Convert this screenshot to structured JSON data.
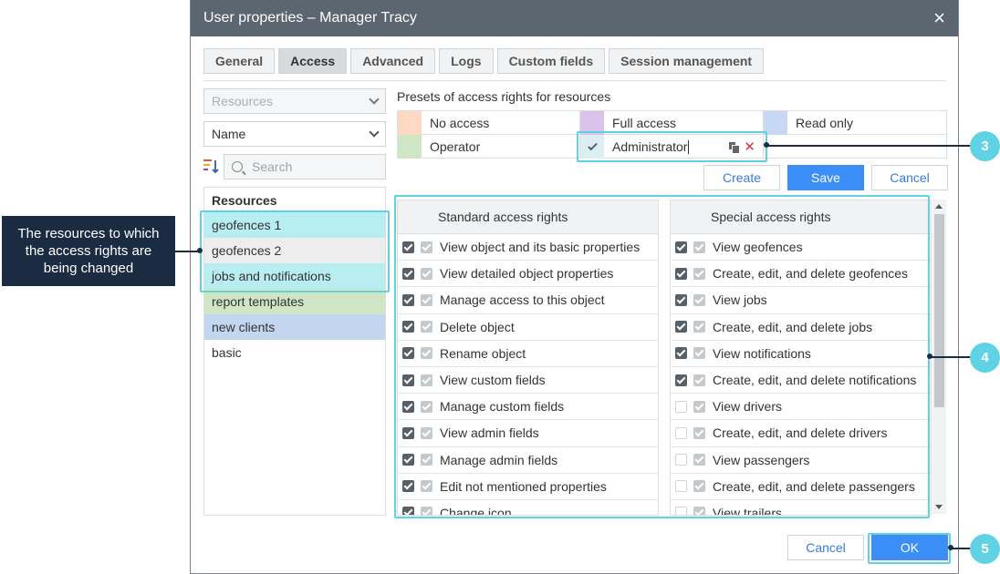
{
  "window": {
    "title": "User properties – Manager Tracy",
    "close": "×"
  },
  "tabs": [
    "General",
    "Access",
    "Advanced",
    "Logs",
    "Custom fields",
    "Session management"
  ],
  "left": {
    "type_select": "Resources",
    "sort_select": "Name",
    "search_placeholder": "Search",
    "list_header": "Resources",
    "items": [
      {
        "label": "geofences 1",
        "color": "#b8eef2"
      },
      {
        "label": "geofences 2",
        "color": "#ededed"
      },
      {
        "label": "jobs and notifications",
        "color": "#b8eef2"
      },
      {
        "label": "report templates",
        "color": "#cfe6c4"
      },
      {
        "label": "new clients",
        "color": "#c3d6f0"
      },
      {
        "label": "basic",
        "color": "#ffffff"
      }
    ]
  },
  "presets": {
    "label": "Presets of access rights for resources",
    "items": [
      {
        "label": "No access",
        "color": "#fdd9c3"
      },
      {
        "label": "Full access",
        "color": "#d9c3ea"
      },
      {
        "label": "Read only",
        "color": "#c6d8f3"
      },
      {
        "label": "Operator",
        "color": "#cfe6c4"
      },
      {
        "label": "Administrator",
        "color": "#ddeef3"
      }
    ],
    "create": "Create",
    "save": "Save",
    "cancel": "Cancel"
  },
  "standard": {
    "header": "Standard access rights",
    "rows": [
      {
        "label": "View object and its basic properties",
        "a": "on"
      },
      {
        "label": "View detailed object properties",
        "a": "on"
      },
      {
        "label": "Manage access to this object",
        "a": "on"
      },
      {
        "label": "Delete object",
        "a": "on"
      },
      {
        "label": "Rename object",
        "a": "on"
      },
      {
        "label": "View custom fields",
        "a": "on"
      },
      {
        "label": "Manage custom fields",
        "a": "on"
      },
      {
        "label": "View admin fields",
        "a": "on"
      },
      {
        "label": "Manage admin fields",
        "a": "on"
      },
      {
        "label": "Edit not mentioned properties",
        "a": "on"
      },
      {
        "label": "Change icon",
        "a": "on"
      }
    ]
  },
  "special": {
    "header": "Special access rights",
    "rows": [
      {
        "label": "View geofences",
        "a": "on"
      },
      {
        "label": "Create, edit, and delete geofences",
        "a": "on"
      },
      {
        "label": "View jobs",
        "a": "on"
      },
      {
        "label": "Create, edit, and delete jobs",
        "a": "on"
      },
      {
        "label": "View notifications",
        "a": "on"
      },
      {
        "label": "Create, edit, and delete notifications",
        "a": "on"
      },
      {
        "label": "View drivers",
        "a": "off"
      },
      {
        "label": "Create, edit, and delete drivers",
        "a": "off"
      },
      {
        "label": "View passengers",
        "a": "off"
      },
      {
        "label": "Create, edit, and delete passengers",
        "a": "off"
      },
      {
        "label": "View trailers",
        "a": "off"
      }
    ]
  },
  "footer": {
    "cancel": "Cancel",
    "ok": "OK"
  },
  "annotations": {
    "note": "The resources to  which the access rights are being changed",
    "c3": "3",
    "c4": "4",
    "c5": "5",
    "highlight_color": "#5fd3e3"
  }
}
